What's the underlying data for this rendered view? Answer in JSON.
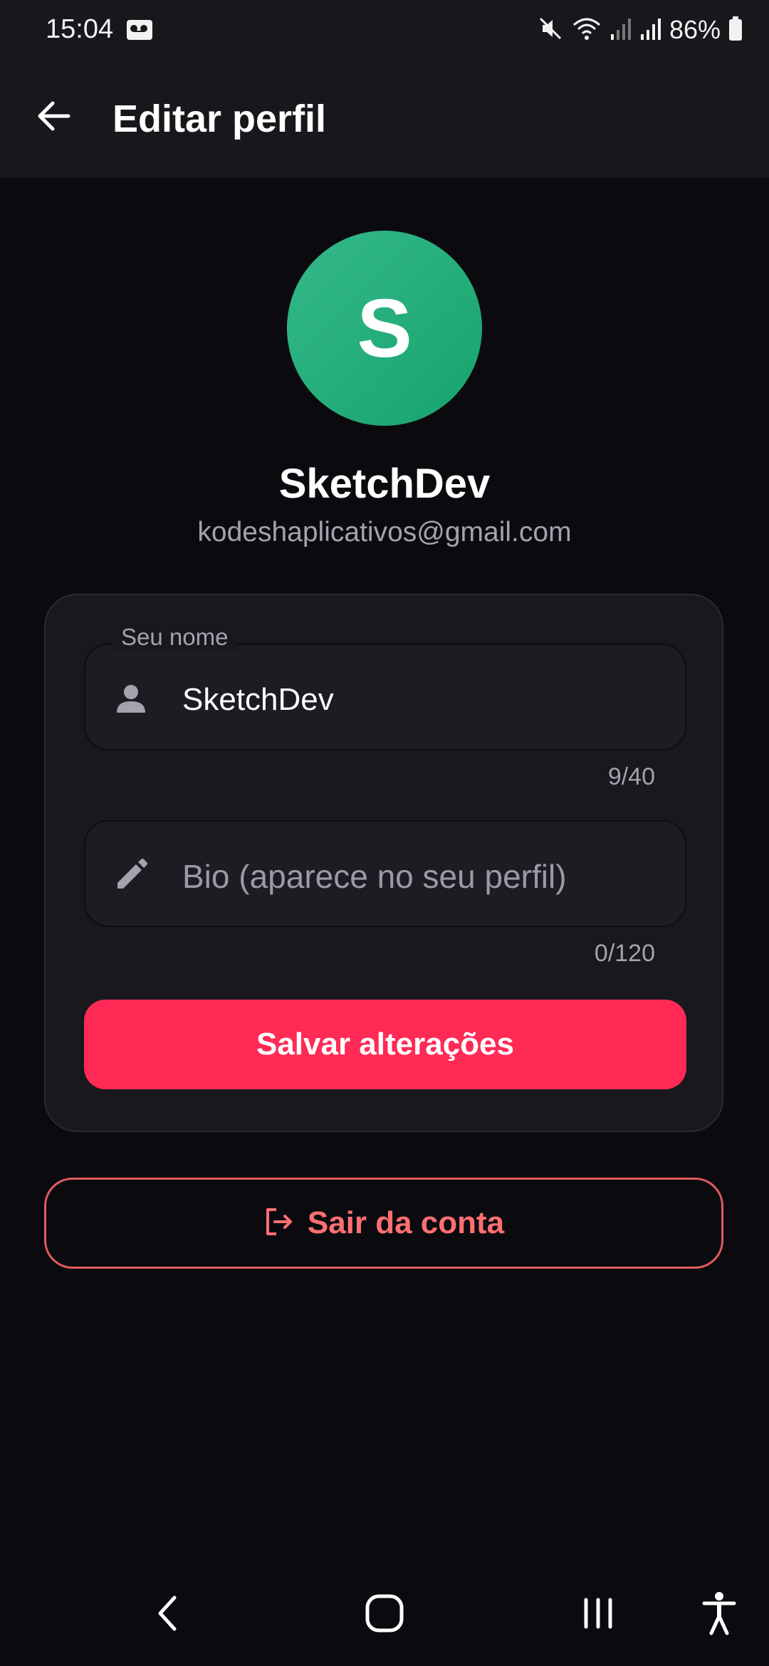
{
  "status_bar": {
    "time": "15:04",
    "battery": "86%"
  },
  "app_bar": {
    "title": "Editar perfil"
  },
  "profile": {
    "avatar_letter": "S",
    "avatar_color": "#1fa874",
    "name": "SketchDev",
    "email": "kodeshaplicativos@gmail.com"
  },
  "form": {
    "name_field": {
      "label": "Seu nome",
      "value": "SketchDev",
      "counter": "9/40",
      "icon": "person-icon"
    },
    "bio_field": {
      "placeholder": "Bio (aparece no seu perfil)",
      "counter": "0/120",
      "icon": "pencil-icon"
    },
    "save_label": "Salvar alterações"
  },
  "logout": {
    "label": "Sair da conta",
    "icon": "logout-icon"
  },
  "colors": {
    "accent": "#ff2a55",
    "danger": "#ff6f72",
    "background": "#0b0b0f"
  }
}
